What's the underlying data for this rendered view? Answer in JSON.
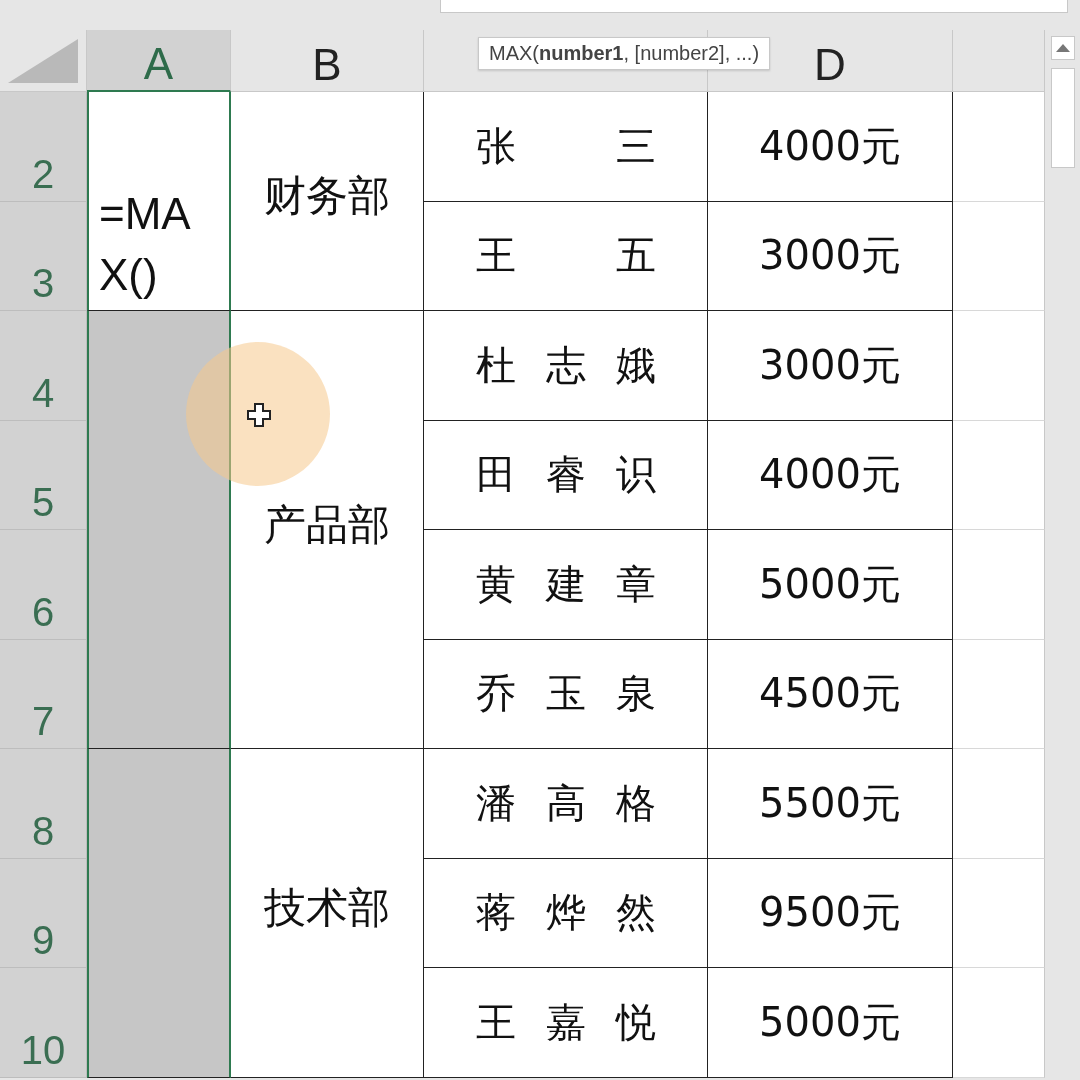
{
  "tooltip": {
    "name": "MAX(",
    "bold_arg": "number1",
    "rest": ", [number2], ...)"
  },
  "columns": [
    {
      "label": "A",
      "selected": true
    },
    {
      "label": "B",
      "selected": false
    },
    {},
    {
      "label": "D",
      "selected": false
    },
    {}
  ],
  "row_numbers": [
    "2",
    "3",
    "4",
    "5",
    "6",
    "7",
    "8",
    "9",
    "10"
  ],
  "departments": [
    {
      "name": "财务部",
      "a_cell": {
        "value": "=MAX()",
        "selected": false
      },
      "employees": [
        {
          "name": "张三",
          "salary": "4000元"
        },
        {
          "name": "王五",
          "salary": "3000元"
        }
      ]
    },
    {
      "name": "产品部",
      "a_cell": {
        "selected": true
      },
      "employees": [
        {
          "name": "杜志娥",
          "salary": "3000元"
        },
        {
          "name": "田睿识",
          "salary": "4000元"
        },
        {
          "name": "黄建章",
          "salary": "5000元"
        },
        {
          "name": "乔玉泉",
          "salary": "4500元"
        }
      ]
    },
    {
      "name": "技术部",
      "a_cell": {
        "selected": true
      },
      "employees": [
        {
          "name": "潘高格",
          "salary": "5500元"
        },
        {
          "name": "蒋烨然",
          "salary": "9500元"
        },
        {
          "name": "王嘉悦",
          "salary": "5000元"
        }
      ]
    }
  ]
}
